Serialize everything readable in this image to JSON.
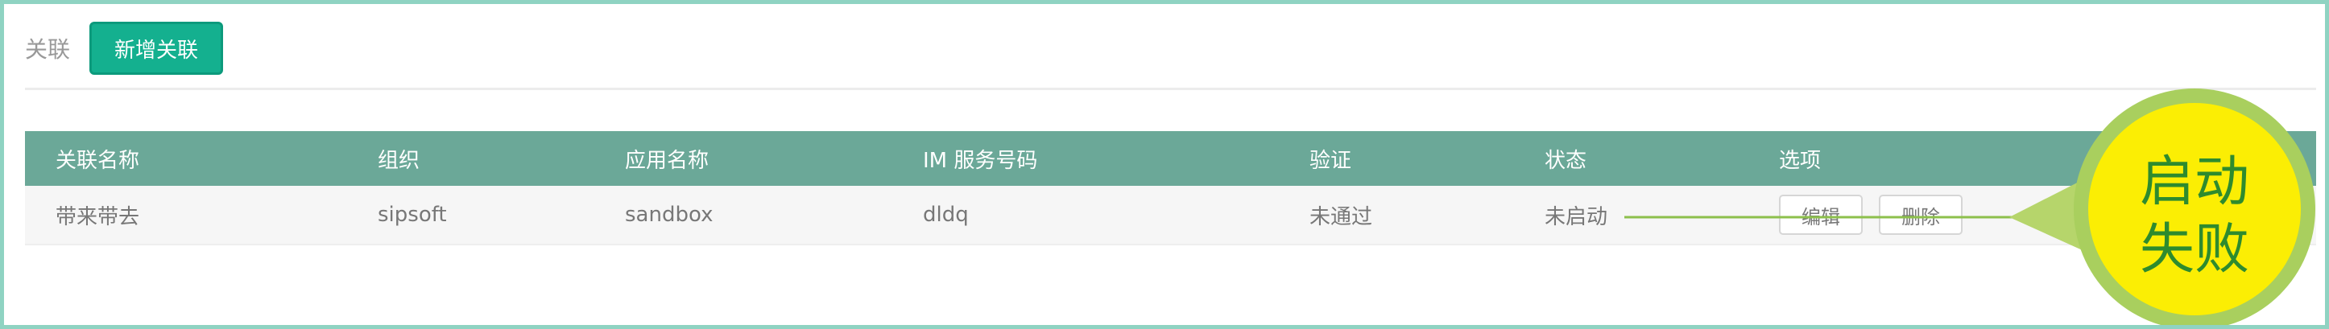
{
  "header": {
    "section_label": "关联",
    "add_button_label": "新增关联"
  },
  "table": {
    "columns": [
      "关联名称",
      "组织",
      "应用名称",
      "IM 服务号码",
      "验证",
      "状态",
      "选项"
    ],
    "rows": [
      {
        "name": "带来带去",
        "org": "sipsoft",
        "app": "sandbox",
        "im_number": "dldq",
        "verify": "未通过",
        "status": "未启动",
        "actions": {
          "edit_label": "编辑",
          "delete_label": "删除"
        }
      }
    ]
  },
  "annotation": {
    "text_line1": "启动",
    "text_line2": "失败",
    "colors": {
      "circle_fill": "#fbee04",
      "ring": "#a9cf5e",
      "pointer": "#b6d56b",
      "text": "#2e8b2e",
      "line": "#8dc04c"
    }
  },
  "colors": {
    "frame_border": "#8fd3c2",
    "accent": "#14b08f",
    "table_header": "#6ba898"
  }
}
